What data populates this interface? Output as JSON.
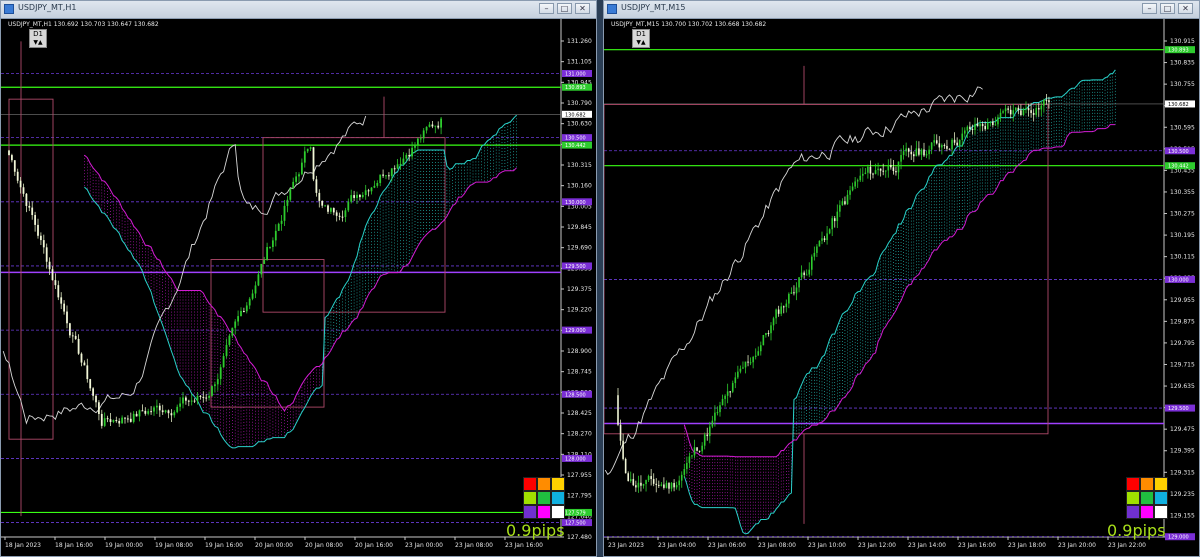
{
  "windows": [
    {
      "id": "left",
      "title": "USDJPY_MT,H1",
      "ohlc": "USDJPY_MT,H1  130.692 130.703 130.647 130.682",
      "timeframe_button": "D1",
      "pips": "0.9pips",
      "y_ticks": [
        "131.260",
        "131.105",
        "130.945",
        "130.790",
        "130.630",
        "130.475",
        "130.315",
        "130.160",
        "130.005",
        "129.845",
        "129.690",
        "129.535",
        "129.375",
        "129.220",
        "129.060",
        "128.900",
        "128.745",
        "128.590",
        "128.425",
        "128.270",
        "128.110",
        "127.955",
        "127.795",
        "127.640",
        "127.480"
      ],
      "x_ticks": [
        "18 Jan 2023",
        "18 Jan 16:00",
        "19 Jan 00:00",
        "19 Jan 08:00",
        "19 Jan 16:00",
        "20 Jan 00:00",
        "20 Jan 08:00",
        "20 Jan 16:00",
        "23 Jan 00:00",
        "23 Jan 08:00",
        "23 Jan 16:00"
      ],
      "price_tags": [
        {
          "text": "131.000",
          "color": "#7b2fd6"
        },
        {
          "text": "130.893",
          "color": "#2ecc2e"
        },
        {
          "text": "130.682",
          "color": "#ffffff"
        },
        {
          "text": "130.500",
          "color": "#7b2fd6"
        },
        {
          "text": "130.442",
          "color": "#2ecc2e"
        },
        {
          "text": "130.000",
          "color": "#7b2fd6"
        },
        {
          "text": "129.500",
          "color": "#7b2fd6"
        },
        {
          "text": "129.000",
          "color": "#7b2fd6"
        },
        {
          "text": "128.500",
          "color": "#7b2fd6"
        },
        {
          "text": "128.000",
          "color": "#7b2fd6"
        },
        {
          "text": "127.579",
          "color": "#2ecc2e"
        },
        {
          "text": "127.500",
          "color": "#7b2fd6"
        }
      ]
    },
    {
      "id": "right",
      "title": "USDJPY_MT,M15",
      "ohlc": "USDJPY_MT,M15  130.700 130.702 130.668 130.682",
      "timeframe_button": "D1",
      "pips": "0.9pips",
      "y_ticks": [
        "130.915",
        "130.835",
        "130.755",
        "130.675",
        "130.595",
        "130.515",
        "130.435",
        "130.355",
        "130.275",
        "130.195",
        "130.115",
        "130.035",
        "129.955",
        "129.875",
        "129.795",
        "129.715",
        "129.635",
        "129.555",
        "129.475",
        "129.395",
        "129.315",
        "129.235",
        "129.155",
        "129.075"
      ],
      "x_ticks": [
        "23 Jan 2023",
        "23 Jan 04:00",
        "23 Jan 06:00",
        "23 Jan 08:00",
        "23 Jan 10:00",
        "23 Jan 12:00",
        "23 Jan 14:00",
        "23 Jan 16:00",
        "23 Jan 18:00",
        "23 Jan 20:00",
        "23 Jan 22:00"
      ],
      "price_tags": [
        {
          "text": "130.893",
          "color": "#2ecc2e"
        },
        {
          "text": "130.682",
          "color": "#ffffff"
        },
        {
          "text": "130.500",
          "color": "#7b2fd6"
        },
        {
          "text": "130.442",
          "color": "#2ecc2e"
        },
        {
          "text": "130.000",
          "color": "#7b2fd6"
        },
        {
          "text": "129.500",
          "color": "#7b2fd6"
        },
        {
          "text": "129.000",
          "color": "#7b2fd6"
        }
      ]
    }
  ],
  "colors": {
    "bull": "#2ecc2e",
    "bear": "#e8f5c8",
    "line_green": "#39ff14",
    "round_level": "#6a3bd6",
    "cloud_up": "#28d0c8",
    "cloud_down": "#d21bd2",
    "box": "#b04a6a",
    "price_line": "#ffffff"
  },
  "palette": [
    "#ff0000",
    "#ff8c00",
    "#ffd000",
    "#a0e000",
    "#20c040",
    "#10b0e0",
    "#7030d0",
    "#ff00ff",
    "#ffffff"
  ]
}
